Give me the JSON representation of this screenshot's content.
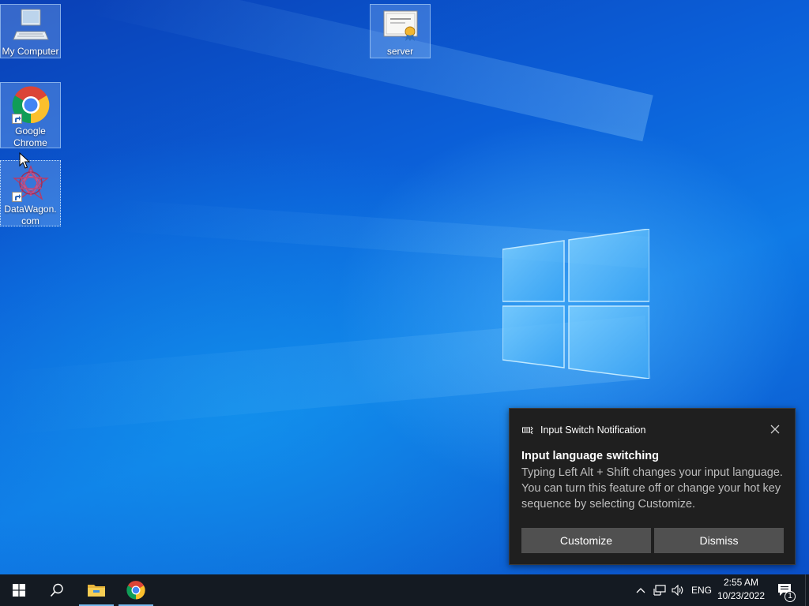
{
  "desktop": {
    "icons": [
      {
        "label": "My Computer",
        "icon": "computer-icon"
      },
      {
        "label": "server",
        "icon": "certificate-icon"
      },
      {
        "label": "Google Chrome",
        "icon": "chrome-icon"
      },
      {
        "label": "DataWagon.com",
        "icon": "datawagon-icon"
      }
    ]
  },
  "notification": {
    "app_name": "Input Switch Notification",
    "title": "Input language switching",
    "body": "Typing Left Alt + Shift changes your input language. You can turn this feature off or change your hot key sequence by selecting Customize.",
    "buttons": {
      "customize": "Customize",
      "dismiss": "Dismiss"
    }
  },
  "taskbar": {
    "pinned": [
      "start-icon",
      "search-icon",
      "file-explorer-icon",
      "chrome-icon"
    ],
    "tray": {
      "language": "ENG",
      "time": "2:55 AM",
      "date": "10/23/2022",
      "notification_count": "1"
    }
  },
  "colors": {
    "accent": "#76b9ed",
    "taskbar": "#141a22",
    "toast_bg": "#1f1f1f",
    "toast_button": "#505050"
  }
}
